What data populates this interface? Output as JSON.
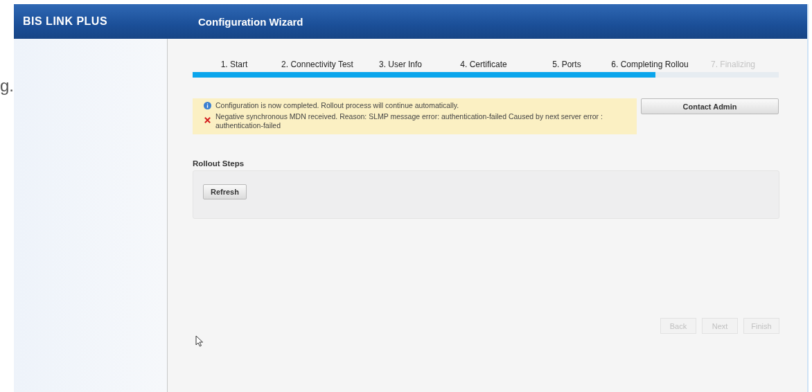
{
  "background_text": "g.",
  "header": {
    "brand": "BIS LINK PLUS",
    "title": "Configuration Wizard"
  },
  "steps": [
    {
      "label": "1. Start",
      "completed": true
    },
    {
      "label": "2. Connectivity Test",
      "completed": true
    },
    {
      "label": "3. User Info",
      "completed": true
    },
    {
      "label": "4. Certificate",
      "completed": true
    },
    {
      "label": "5. Ports",
      "completed": true
    },
    {
      "label": "6. Completing Rollou",
      "completed": true
    },
    {
      "label": "7. Finalizing",
      "completed": false
    }
  ],
  "progress": {
    "level": 0.79
  },
  "messages": [
    {
      "kind": "info",
      "text": "Configuration is now completed. Rollout process will continue automatically."
    },
    {
      "kind": "error",
      "text": "Negative synchronous MDN received. Reason: SLMP message error: authentication-failed Caused by next server error : authentication-failed"
    }
  ],
  "contact_button": "Contact Admin",
  "rollout": {
    "title": "Rollout Steps",
    "refresh_button": "Refresh"
  },
  "nav_buttons": [
    {
      "label": "Back",
      "disabled": true
    },
    {
      "label": "Next",
      "disabled": true
    },
    {
      "label": "Finish",
      "disabled": true
    }
  ]
}
